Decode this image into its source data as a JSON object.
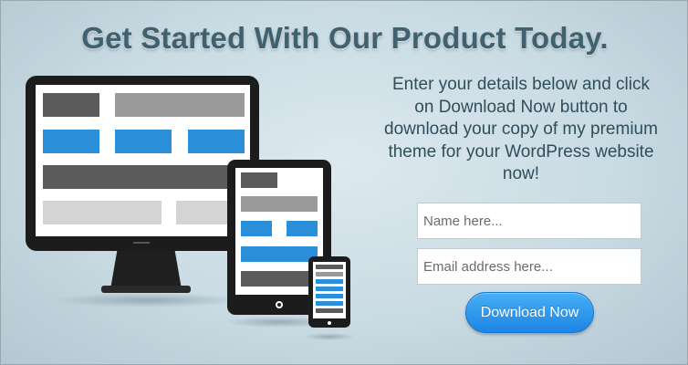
{
  "headline": "Get Started With Our Product Today.",
  "description": "Enter your details below and click on Download Now button to download your copy of my premium theme for your WordPress website now!",
  "form": {
    "name_placeholder": "Name here...",
    "name_value": "",
    "email_placeholder": "Email address here...",
    "email_value": "",
    "button_label": "Download Now"
  },
  "colors": {
    "headline": "#3f6170",
    "accent_blue": "#2a8fd8",
    "button": "#2a93ea"
  },
  "illustration": [
    "desktop-monitor-icon",
    "tablet-icon",
    "smartphone-icon"
  ]
}
